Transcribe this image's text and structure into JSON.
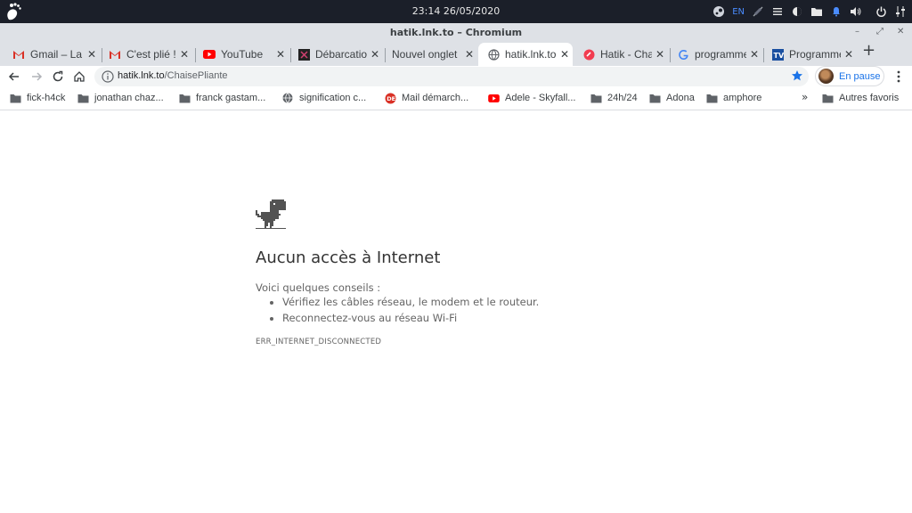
{
  "system": {
    "clock": "23:14 26/05/2020",
    "keyboard_layout": "EN",
    "icons": [
      "steam-icon",
      "keyboard-layout",
      "network-off-icon",
      "menu-icon",
      "night-mode-icon",
      "folder-icon",
      "notification-bell-icon",
      "volume-icon",
      "power-icon",
      "settings-icon"
    ]
  },
  "window": {
    "title": "hatik.lnk.to – Chromium"
  },
  "tabs": [
    {
      "title": "Gmail – La m",
      "icon": "gmail-icon",
      "active": false
    },
    {
      "title": "C'est plié !",
      "icon": "gmail-icon",
      "active": false
    },
    {
      "title": "YouTube",
      "icon": "youtube-icon",
      "active": false
    },
    {
      "title": "Débarcatio",
      "icon": "site-icon",
      "active": false
    },
    {
      "title": "Nouvel onglet",
      "icon": "none",
      "active": false
    },
    {
      "title": "hatik.lnk.to",
      "icon": "globe-icon",
      "active": true
    },
    {
      "title": "Hatik - Chai",
      "icon": "lnk-icon",
      "active": false
    },
    {
      "title": "programme",
      "icon": "google-icon",
      "active": false
    },
    {
      "title": "Programme",
      "icon": "tv-icon",
      "active": false
    }
  ],
  "toolbar": {
    "url_host": "hatik.lnk.to",
    "url_path": "/ChaisePliante",
    "profile_label": "En pause"
  },
  "bookmarks": [
    {
      "label": "fick-h4ck",
      "icon": "folder-icon"
    },
    {
      "label": "jonathan chaz...",
      "icon": "folder-icon"
    },
    {
      "label": "franck gastam...",
      "icon": "folder-icon"
    },
    {
      "label": "signification c...",
      "icon": "globe-icon"
    },
    {
      "label": "Mail démarch...",
      "icon": "mail-site-icon"
    },
    {
      "label": "Adele - Skyfall...",
      "icon": "youtube-icon"
    },
    {
      "label": "24h/24",
      "icon": "folder-icon"
    },
    {
      "label": "Adona",
      "icon": "folder-icon"
    },
    {
      "label": "amphore",
      "icon": "folder-icon"
    }
  ],
  "bookmarks_overflow": "»",
  "other_bookmarks": "Autres favoris",
  "error": {
    "title": "Aucun accès à Internet",
    "suggestions_heading": "Voici quelques conseils :",
    "suggestions": [
      "Vérifiez les câbles réseau, le modem et le routeur.",
      "Reconnectez-vous au réseau Wi-Fi"
    ],
    "code": "ERR_INTERNET_DISCONNECTED"
  },
  "colors": {
    "system_panel": "#1b1f29",
    "tabstrip": "#dee1e6",
    "accent": "#1a73e8"
  }
}
